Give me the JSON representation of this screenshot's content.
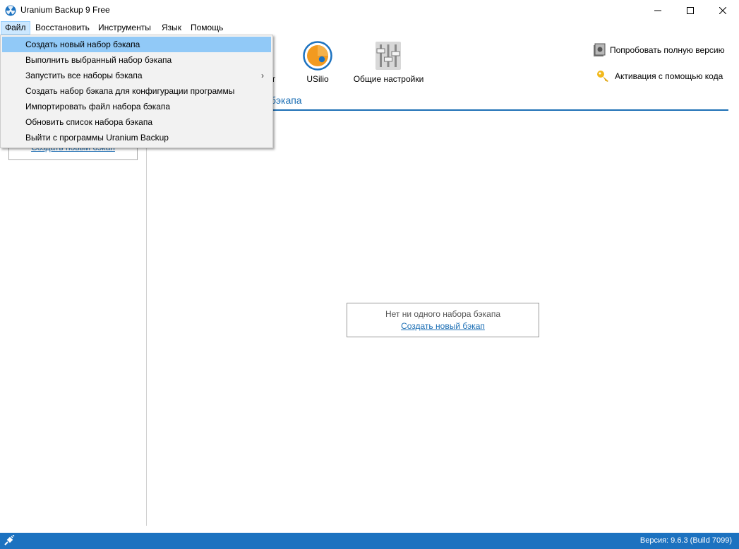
{
  "window": {
    "title": "Uranium Backup 9 Free"
  },
  "menubar": {
    "items": [
      "Файл",
      "Восстановить",
      "Инструменты",
      "Язык",
      "Помощь"
    ]
  },
  "toolbar": {
    "partial_label": "нт",
    "usilio_label": "USilio",
    "settings_label": "Общие настройки",
    "try_full": "Попробовать полную версию",
    "activation": "Активация с помощью кода"
  },
  "content": {
    "tab_label": "бэкапа",
    "left_link": "Создать новый бэкап",
    "empty_text": "Нет ни одного набора бэкапа",
    "empty_link": "Создать новый бэкап"
  },
  "file_menu": {
    "items": [
      {
        "label": "Создать новый набор бэкапа",
        "highlighted": true
      },
      {
        "label": "Выполнить выбранный набор бэкапа"
      },
      {
        "label": "Запустить все наборы бэкапа",
        "submenu": true
      },
      {
        "label": "Создать набор бэкапа для конфигурации программы"
      },
      {
        "label": "Импортировать файл набора бэкапа"
      },
      {
        "label": "Обновить список набора бэкапа"
      },
      {
        "label": "Выйти с программы Uranium Backup"
      }
    ]
  },
  "statusbar": {
    "version": "Версия: 9.6.3 (Build 7099)"
  },
  "colors": {
    "accent": "#1c72c0",
    "link": "#1c6fb5",
    "menu_highlight": "#91c9f7"
  }
}
